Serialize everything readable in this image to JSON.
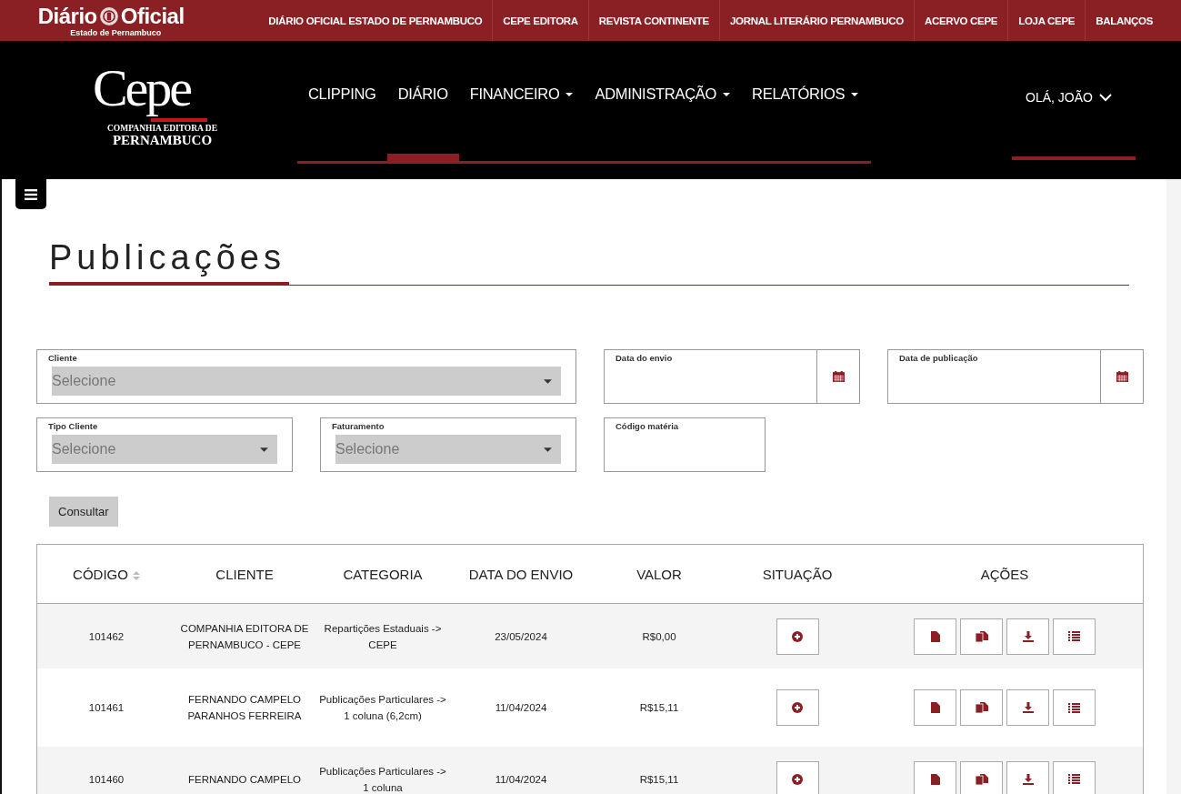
{
  "top_bar": {
    "brand": {
      "title": "Diário",
      "title_2": "Oficial",
      "subtitle": "Estado de Pernambuco"
    },
    "links": [
      "DIÁRIO OFICIAL ESTADO DE PERNAMBUCO",
      "CEPE EDITORA",
      "REVISTA CONTINENTE",
      "JORNAL LITERÁRIO PERNAMBUCO",
      "ACERVO CEPE",
      "LOJA CEPE",
      "BALANÇOS"
    ]
  },
  "header": {
    "logo": {
      "word": "Cepe",
      "line_1": "COMPANHIA EDITORA DE",
      "line_2": "PERNAMBUCO"
    },
    "nav": [
      {
        "label": "CLIPPING",
        "dropdown": false,
        "selected": false
      },
      {
        "label": "DIÁRIO",
        "dropdown": false,
        "selected": true
      },
      {
        "label": "FINANCEIRO",
        "dropdown": true,
        "selected": false
      },
      {
        "label": "ADMINISTRAÇÃO",
        "dropdown": true,
        "selected": false
      },
      {
        "label": "RELATÓRIOS",
        "dropdown": true,
        "selected": false
      }
    ],
    "user_menu": "OLÁ, JOÃO"
  },
  "page": {
    "title": "Publicações"
  },
  "filters": [
    {
      "kind": "select",
      "label": "Cliente",
      "placeholder": "Selecione"
    },
    {
      "kind": "date",
      "label": "Data do envio"
    },
    {
      "kind": "date",
      "label": "Data de publicação"
    },
    {
      "kind": "select",
      "label": "Tipo Cliente",
      "placeholder": "Selecione"
    },
    {
      "kind": "select",
      "label": "Faturamento",
      "placeholder": "Selecione"
    },
    {
      "kind": "text",
      "label": "Código matéria"
    }
  ],
  "search_button": "Consultar",
  "table": {
    "columns": [
      {
        "label": "CÓDIGO",
        "sortable": true
      },
      {
        "label": "CLIENTE",
        "sortable": false
      },
      {
        "label": "CATEGORIA",
        "sortable": false
      },
      {
        "label": "DATA DO ENVIO",
        "sortable": false
      },
      {
        "label": "VALOR",
        "sortable": false
      },
      {
        "label": "SITUAÇÃO",
        "sortable": false
      },
      {
        "label": "AÇÕES",
        "sortable": false
      }
    ],
    "rows": [
      {
        "codigo": "101462",
        "cliente": "COMPANHIA EDITORA DE PERNAMBUCO - CEPE",
        "categoria": "Repartições Estaduais -> CEPE",
        "data": "23/05/2024",
        "valor": "R$0,00"
      },
      {
        "codigo": "101461",
        "cliente": "FERNANDO CAMPELO PARANHOS FERREIRA",
        "categoria": "Publicações Particulares -> 1 coluna (6,2cm)",
        "data": "11/04/2024",
        "valor": "R$15,11"
      },
      {
        "codigo": "101460",
        "cliente": "FERNANDO CAMPELO",
        "categoria": "Publicações Particulares -> 1 coluna",
        "data": "11/04/2024",
        "valor": "R$15,11"
      }
    ]
  }
}
